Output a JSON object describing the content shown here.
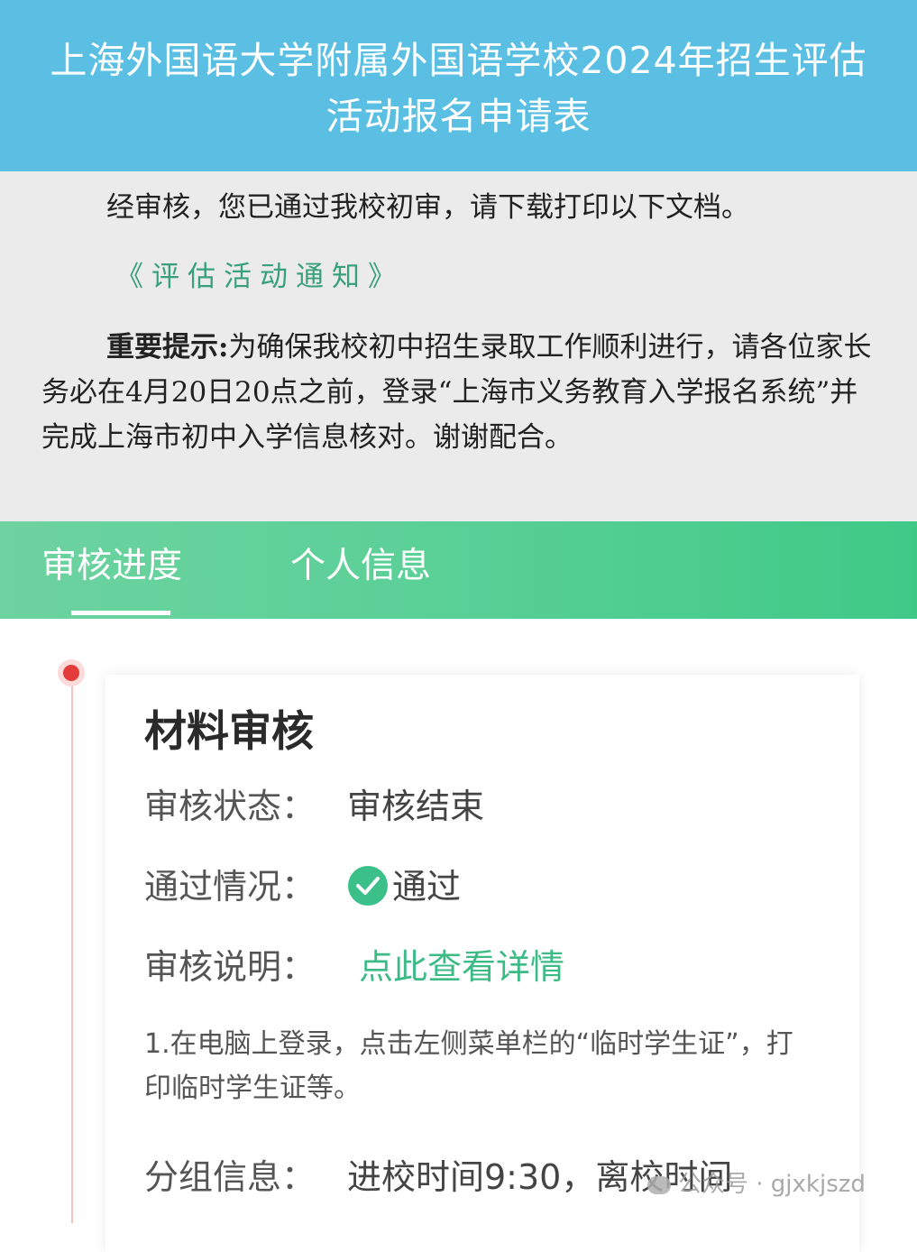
{
  "header": {
    "title_line1": "上海外国语大学附属外国语学校2024年招生评估",
    "title_line2": "活动报名申请表"
  },
  "notice": {
    "passed_text": "经审核，您已通过我校初审，请下载打印以下文档。",
    "doc_link": "《评估活动通知》",
    "important_label": "重要提示:",
    "important_text": "为确保我校初中招生录取工作顺利进行，请各位家长务必在4月20日20点之前，登录“上海市义务教育入学报名系统”并完成上海市初中入学信息核对。谢谢配合。"
  },
  "tabs": [
    {
      "label": "审核进度",
      "active": true
    },
    {
      "label": "个人信息",
      "active": false
    }
  ],
  "card": {
    "title": "材料审核",
    "status_label": "审核状态：",
    "status_value": "审核结束",
    "pass_label": "通过情况：",
    "pass_value": "通过",
    "pass_icon": "check-circle-icon",
    "desc_label": "审核说明：",
    "desc_link": "点此查看详情",
    "desc_text": "1.在电脑上登录，点击左侧菜单栏的“临时学生证”，打印临时学生证等。",
    "group_label": "分组信息：",
    "group_value": "进校时间9:30，离校时间"
  },
  "watermark": {
    "text": "公众号 · gjxkjszd"
  },
  "colors": {
    "header_bg": "#5bbfe3",
    "notice_bg": "#ebebeb",
    "tab_bg": "#57cf95",
    "link_green": "#3dbb86",
    "timeline_dot": "#e43b3b"
  }
}
